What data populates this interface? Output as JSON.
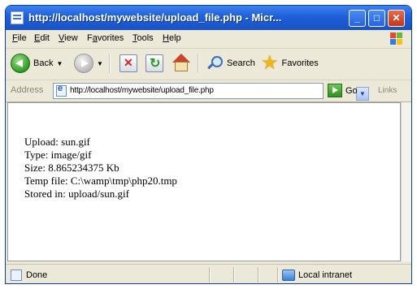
{
  "window": {
    "title": "http://localhost/mywebsite/upload_file.php - Micr..."
  },
  "menu": {
    "items": [
      {
        "u": "F",
        "rest": "ile"
      },
      {
        "u": "E",
        "rest": "dit"
      },
      {
        "u": "V",
        "rest": "iew"
      },
      {
        "pre": "F",
        "u": "a",
        "rest": "vorites"
      },
      {
        "u": "T",
        "rest": "ools"
      },
      {
        "u": "H",
        "rest": "elp"
      }
    ]
  },
  "toolbar": {
    "back_label": "Back",
    "search_label": "Search",
    "favorites_label": "Favorites"
  },
  "address": {
    "label": "Address",
    "url": "http://localhost/mywebsite/upload_file.php",
    "go_label": "Go",
    "links_label": "Links"
  },
  "content": {
    "lines": [
      "Upload: sun.gif",
      "Type: image/gif",
      "Size: 8.865234375 Kb",
      "Temp file: C:\\wamp\\tmp\\php20.tmp",
      "Stored in: upload/sun.gif"
    ]
  },
  "status": {
    "text": "Done",
    "zone": "Local intranet"
  },
  "colors": {
    "titlebar": "#1f5fd9",
    "chrome": "#ece9d8"
  }
}
